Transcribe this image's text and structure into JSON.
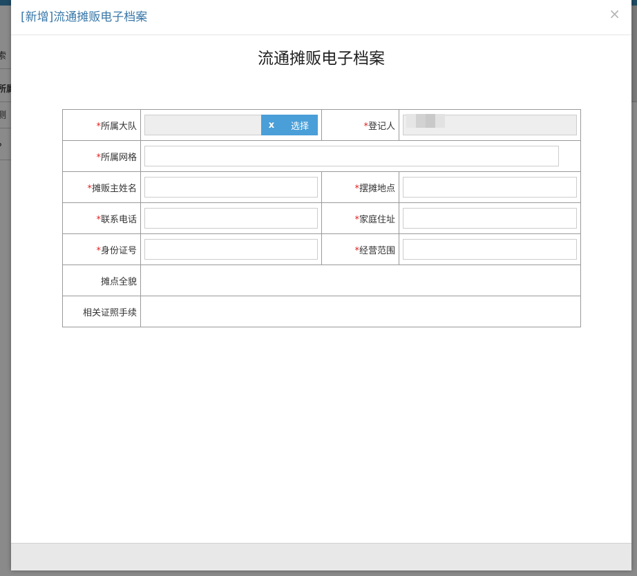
{
  "background": {
    "fragments": [
      "索",
      "所属",
      "测",
      "?"
    ]
  },
  "modal": {
    "title": "[新增]流通摊贩电子档案",
    "close_symbol": "×"
  },
  "form": {
    "heading": "流通摊贩电子档案",
    "required_mark": "*",
    "fields": {
      "team": {
        "label": "所属大队",
        "value": "",
        "clear_label": "x",
        "choose_label": "选择"
      },
      "registrant": {
        "label": "登记人",
        "value": ""
      },
      "grid": {
        "label": "所属网格",
        "value": ""
      },
      "vendor_name": {
        "label": "摊贩主姓名",
        "value": ""
      },
      "stall_location": {
        "label": "摆摊地点",
        "value": ""
      },
      "phone": {
        "label": "联系电话",
        "value": ""
      },
      "home_address": {
        "label": "家庭住址",
        "value": ""
      },
      "id_number": {
        "label": "身份证号",
        "value": ""
      },
      "business_scope": {
        "label": "经营范围",
        "value": ""
      },
      "stall_overview": {
        "label": "摊点全貌"
      },
      "licenses": {
        "label": "相关证照手续"
      }
    }
  },
  "colors": {
    "title": "#3a78a8",
    "required": "#e02020",
    "button": "#4a9fd8"
  }
}
